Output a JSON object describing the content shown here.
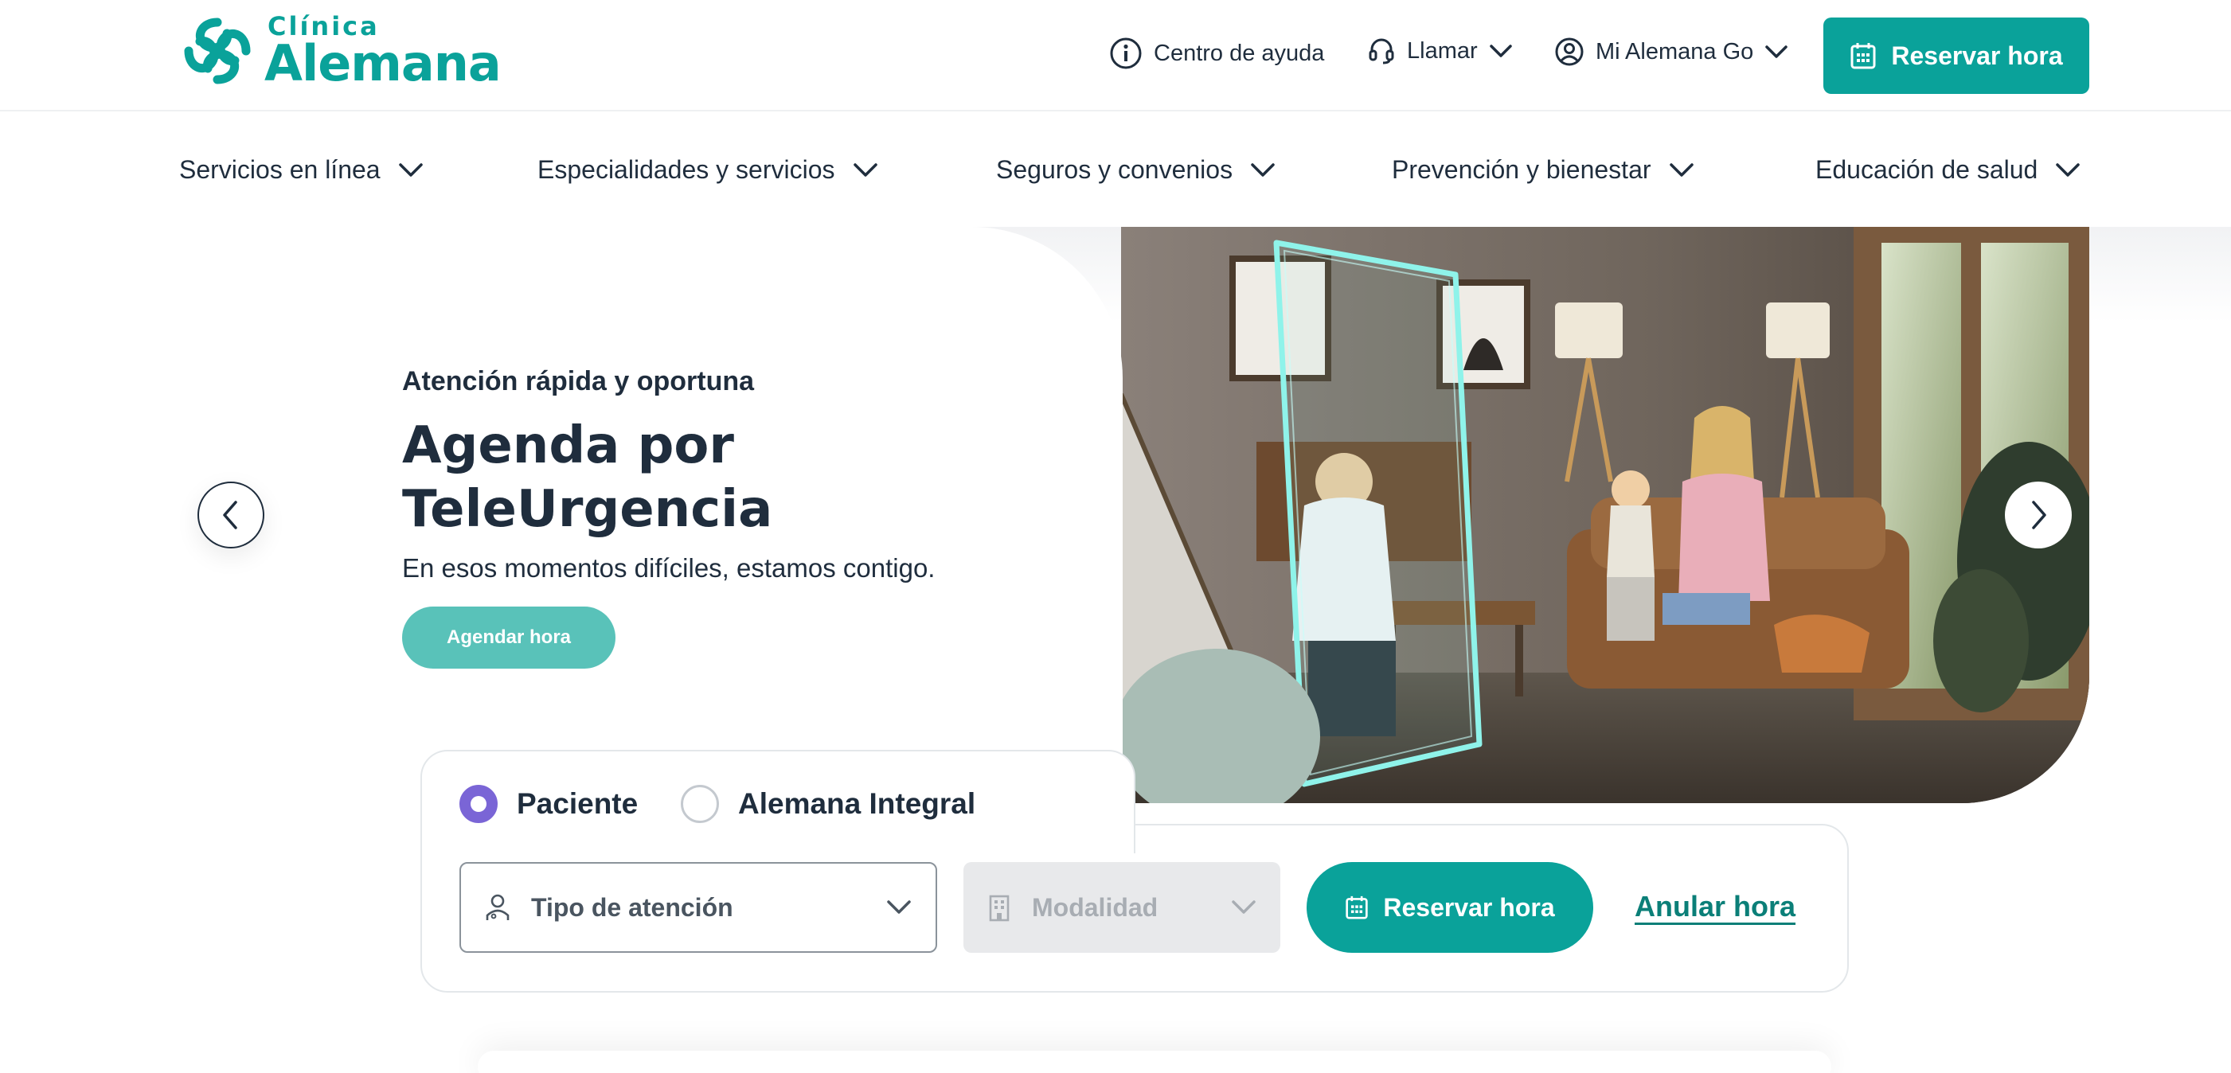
{
  "brand": {
    "small": "Clínica",
    "big": "Alemana",
    "color": "#0aa29a"
  },
  "header": {
    "help": {
      "label": "Centro de ayuda",
      "icon": "info-circle-icon"
    },
    "call": {
      "label": "Llamar",
      "icon": "headset-icon"
    },
    "account": {
      "label": "Mi Alemana Go",
      "icon": "user-circle-icon"
    },
    "reserve": {
      "label": "Reservar hora",
      "icon": "calendar-icon"
    }
  },
  "nav": [
    {
      "label": "Servicios en línea"
    },
    {
      "label": "Especialidades y servicios"
    },
    {
      "label": "Seguros y convenios"
    },
    {
      "label": "Prevención y bienestar"
    },
    {
      "label": "Educación de salud"
    }
  ],
  "hero": {
    "eyebrow": "Atención rápida y oportuna",
    "title": "Agenda por TeleUrgencia",
    "subtitle": "En esos momentos difíciles, estamos contigo.",
    "cta": "Agendar hora",
    "image": "telemedicine-family-living-room-photo"
  },
  "booking": {
    "options": [
      {
        "label": "Paciente",
        "selected": true
      },
      {
        "label": "Alemana Integral",
        "selected": false
      }
    ],
    "tipo": {
      "label": "Tipo de atención",
      "icon": "user-icon"
    },
    "modalidad": {
      "label": "Modalidad",
      "icon": "building-icon",
      "disabled": true
    },
    "reserve": "Reservar hora",
    "cancel": "Anular hora"
  },
  "colors": {
    "primary": "#0aa29a",
    "cta_light": "#59c2b9",
    "radio": "#7a65d6",
    "text": "#1f2d3d"
  }
}
